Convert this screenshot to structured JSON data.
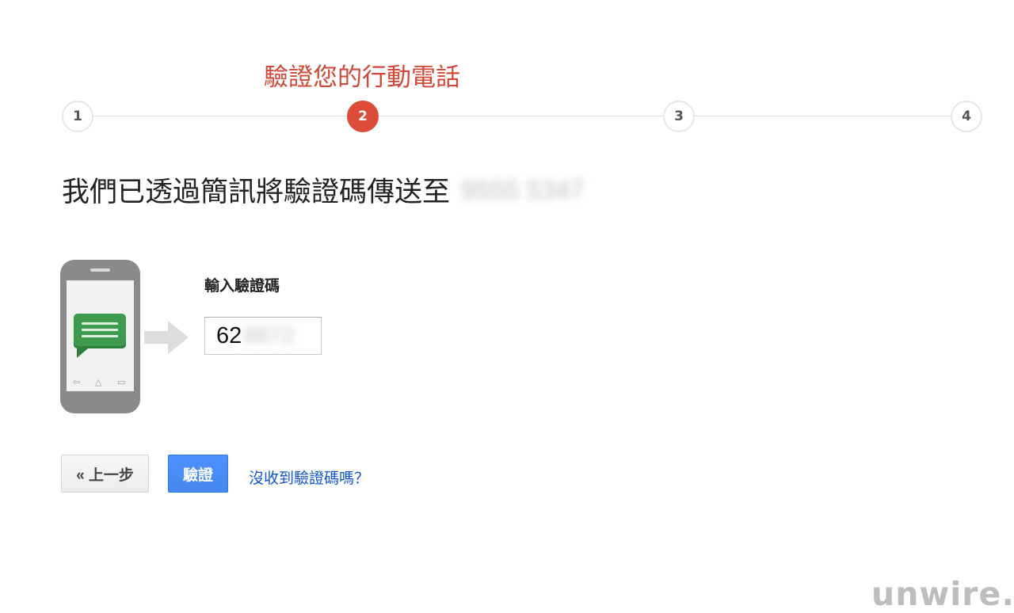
{
  "stepper": {
    "title": "驗證您的行動電話",
    "steps": [
      "1",
      "2",
      "3",
      "4"
    ],
    "active_step": 2,
    "active_color": "#dd4b39"
  },
  "message": {
    "text": "我們已透過簡訊將驗證碼傳送至",
    "phone_number_masked": "9555 5347"
  },
  "illustration": {
    "phone_icon": "phone-icon",
    "message_icon": "chat-bubble-icon",
    "arrow_icon": "arrow-right-icon",
    "nav_icons": [
      "back-icon",
      "home-icon",
      "recent-apps-icon"
    ]
  },
  "code_input": {
    "label": "輸入驗證碼",
    "value_visible": "62",
    "value_masked": "8872"
  },
  "actions": {
    "back_label": "« 上一步",
    "verify_label": "驗證",
    "no_code_link": "沒收到驗證碼嗎？",
    "verify_color": "#4d90fe",
    "link_color": "#1155cc"
  },
  "watermark": "unwire.hk"
}
